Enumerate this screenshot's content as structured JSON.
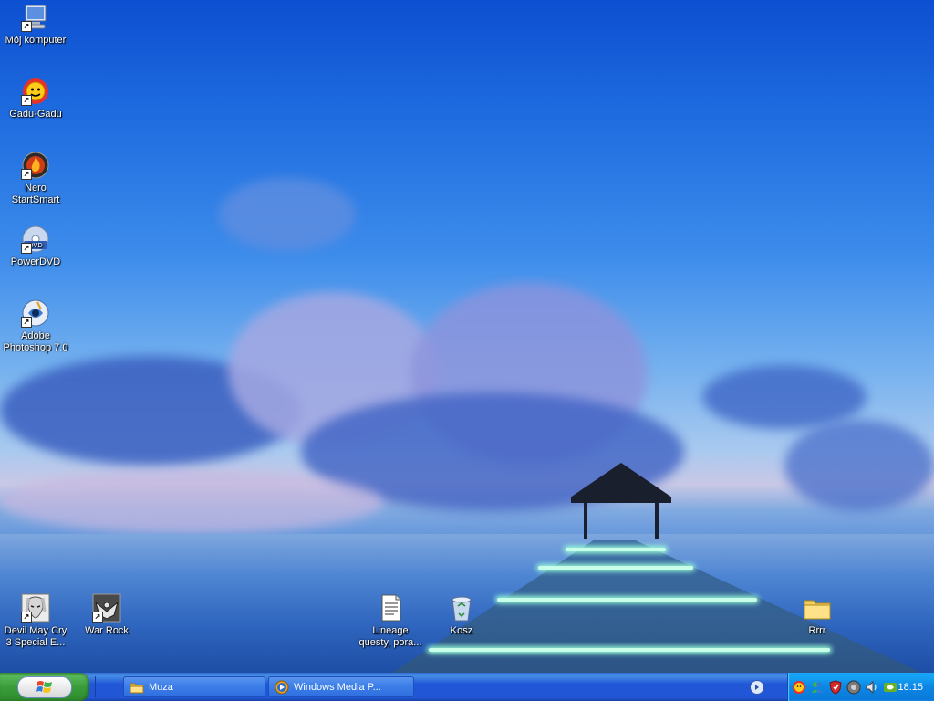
{
  "desktop": {
    "icons": [
      {
        "label": "Mój komputer",
        "shortcut": true
      },
      {
        "label": "Gadu-Gadu",
        "shortcut": true
      },
      {
        "label": "Nero\nStartSmart",
        "shortcut": true
      },
      {
        "label": "PowerDVD",
        "shortcut": true
      },
      {
        "label": "Adobe\nPhotoshop 7.0",
        "shortcut": true
      },
      {
        "label": "Devil May Cry\n3 Special E...",
        "shortcut": true
      },
      {
        "label": "War Rock",
        "shortcut": true
      },
      {
        "label": "Lineage\nquesty, pora...",
        "shortcut": false
      },
      {
        "label": "Kosz",
        "shortcut": false
      },
      {
        "label": "Rrrr",
        "shortcut": false
      }
    ]
  },
  "taskbar": {
    "start_label": "start",
    "buttons": [
      {
        "label": "Muza",
        "icon": "folder-icon"
      },
      {
        "label": "Windows Media P...",
        "icon": "media-player-icon"
      }
    ],
    "tray": {
      "icons": [
        "gadu-gadu-tray-icon",
        "messenger-tray-icon",
        "antivirus-tray-icon",
        "network-tray-icon",
        "volume-tray-icon",
        "nvidia-tray-icon"
      ],
      "clock": "18:15"
    }
  },
  "colors": {
    "taskbar_blue": "#2157d7",
    "start_green": "#3a9d3a",
    "tray_blue": "#0c86e4"
  }
}
